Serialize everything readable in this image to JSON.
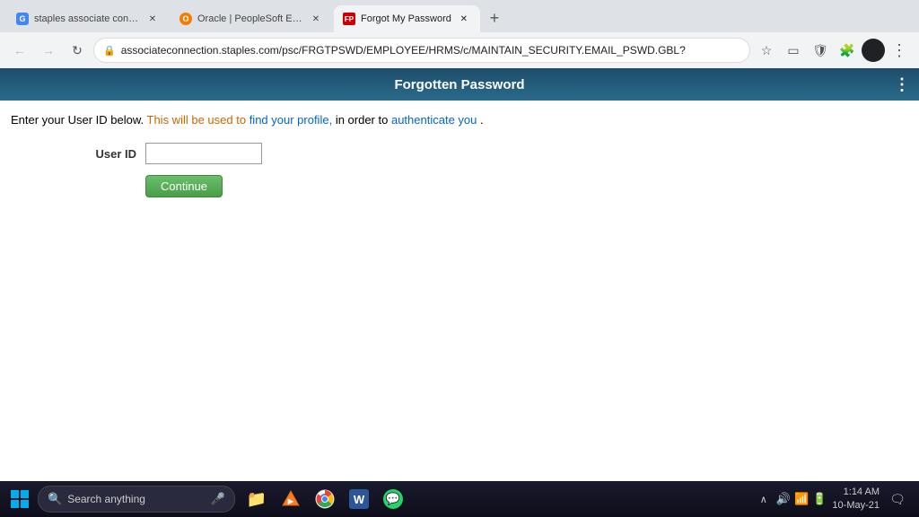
{
  "browser": {
    "tabs": [
      {
        "id": "tab1",
        "favicon": "G",
        "favicon_color": "#4285f4",
        "label": "staples associate connection log...",
        "active": false
      },
      {
        "id": "tab2",
        "favicon": "O",
        "favicon_color": "#f57c00",
        "label": "Oracle | PeopleSoft Enterprise Se...",
        "active": false
      },
      {
        "id": "tab3",
        "favicon": "FP",
        "favicon_color": "#cc0000",
        "label": "Forgot My Password",
        "active": true
      }
    ],
    "address": "associateconnection.staples.com/psc/FRGTPSWD/EMPLOYEE/HRMS/c/MAINTAIN_SECURITY.EMAIL_PSWD.GBL?",
    "menu_icon": "⋮"
  },
  "page": {
    "title": "Forgotten Password",
    "instruction": {
      "prefix": "Enter your User ID below.",
      "highlight1": " This will be used to ",
      "link1": "find your profile,",
      "middle": " in order to ",
      "link2": "authenticate you",
      "suffix": "."
    },
    "form": {
      "user_id_label": "User ID",
      "user_id_placeholder": "",
      "continue_label": "Continue"
    }
  },
  "taskbar": {
    "search_placeholder": "Search anything",
    "clock_time": "1:14 AM",
    "clock_date": "10-May-21",
    "apps": [
      {
        "id": "file-explorer",
        "icon": "📁"
      },
      {
        "id": "vlc",
        "icon": "🎵"
      },
      {
        "id": "chrome",
        "icon": "🌐"
      },
      {
        "id": "word",
        "icon": "W"
      },
      {
        "id": "whatsapp",
        "icon": "💬"
      }
    ]
  }
}
